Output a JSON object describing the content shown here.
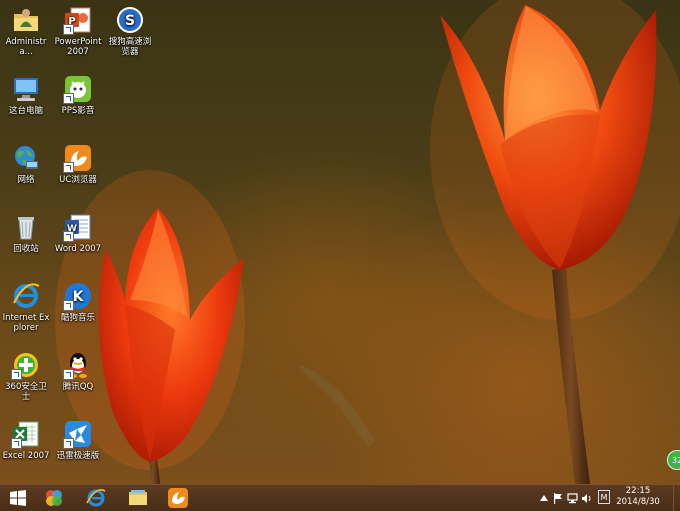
{
  "desktop": {
    "icons": [
      {
        "label": "Administra...",
        "icon": "user-folder-icon"
      },
      {
        "label": "PowerPoint 2007",
        "icon": "powerpoint-icon"
      },
      {
        "label": "搜狗高速浏览器",
        "icon": "sogou-browser-icon"
      },
      {
        "label": "这台电脑",
        "icon": "computer-icon"
      },
      {
        "label": "PPS影音",
        "icon": "pps-icon"
      },
      {
        "label": "网络",
        "icon": "network-icon"
      },
      {
        "label": "UC浏览器",
        "icon": "uc-browser-icon"
      },
      {
        "label": "回收站",
        "icon": "recycle-bin-icon"
      },
      {
        "label": "Word 2007",
        "icon": "word-icon"
      },
      {
        "label": "Internet Explorer",
        "icon": "ie-icon"
      },
      {
        "label": "酷狗音乐",
        "icon": "kugou-icon"
      },
      {
        "label": "360安全卫士",
        "icon": "360-icon"
      },
      {
        "label": "腾讯QQ",
        "icon": "qq-icon"
      },
      {
        "label": "Excel 2007",
        "icon": "excel-icon"
      },
      {
        "label": "迅雷极速版",
        "icon": "xunlei-icon"
      }
    ]
  },
  "taskbar": {
    "start": "windows-logo-icon",
    "pinned": [
      "photo-app-icon",
      "ie-icon",
      "file-explorer-icon",
      "uc-browser-icon"
    ],
    "tray": {
      "ime": "M",
      "time": "22:15",
      "date": "2014/8/30"
    }
  },
  "badge": {
    "text": "32"
  },
  "colors": {
    "taskbar": "#4f3119",
    "accent": "#ff6a1a"
  }
}
